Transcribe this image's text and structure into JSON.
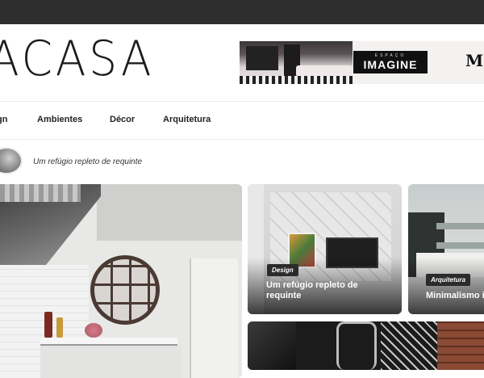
{
  "header": {
    "logo_text": "ACASA",
    "banner": {
      "brand_small": "ESPAÇO",
      "brand_big": "IMAGINE",
      "right_text": "M"
    }
  },
  "nav": {
    "items": [
      {
        "label": "gn"
      },
      {
        "label": "Ambientes"
      },
      {
        "label": "Décor"
      },
      {
        "label": "Arquitetura"
      }
    ]
  },
  "featured": {
    "caption": "Um refúgio repleto de requinte"
  },
  "cards": [
    {
      "tag": "Design",
      "title": "Um refúgio repleto de requinte"
    },
    {
      "tag": "Arquitetura",
      "title": "Minimalismo in"
    }
  ],
  "colors": {
    "topbar": "#2e2e2e",
    "tag_bg": "#2b2b2b",
    "text": "#222222"
  }
}
